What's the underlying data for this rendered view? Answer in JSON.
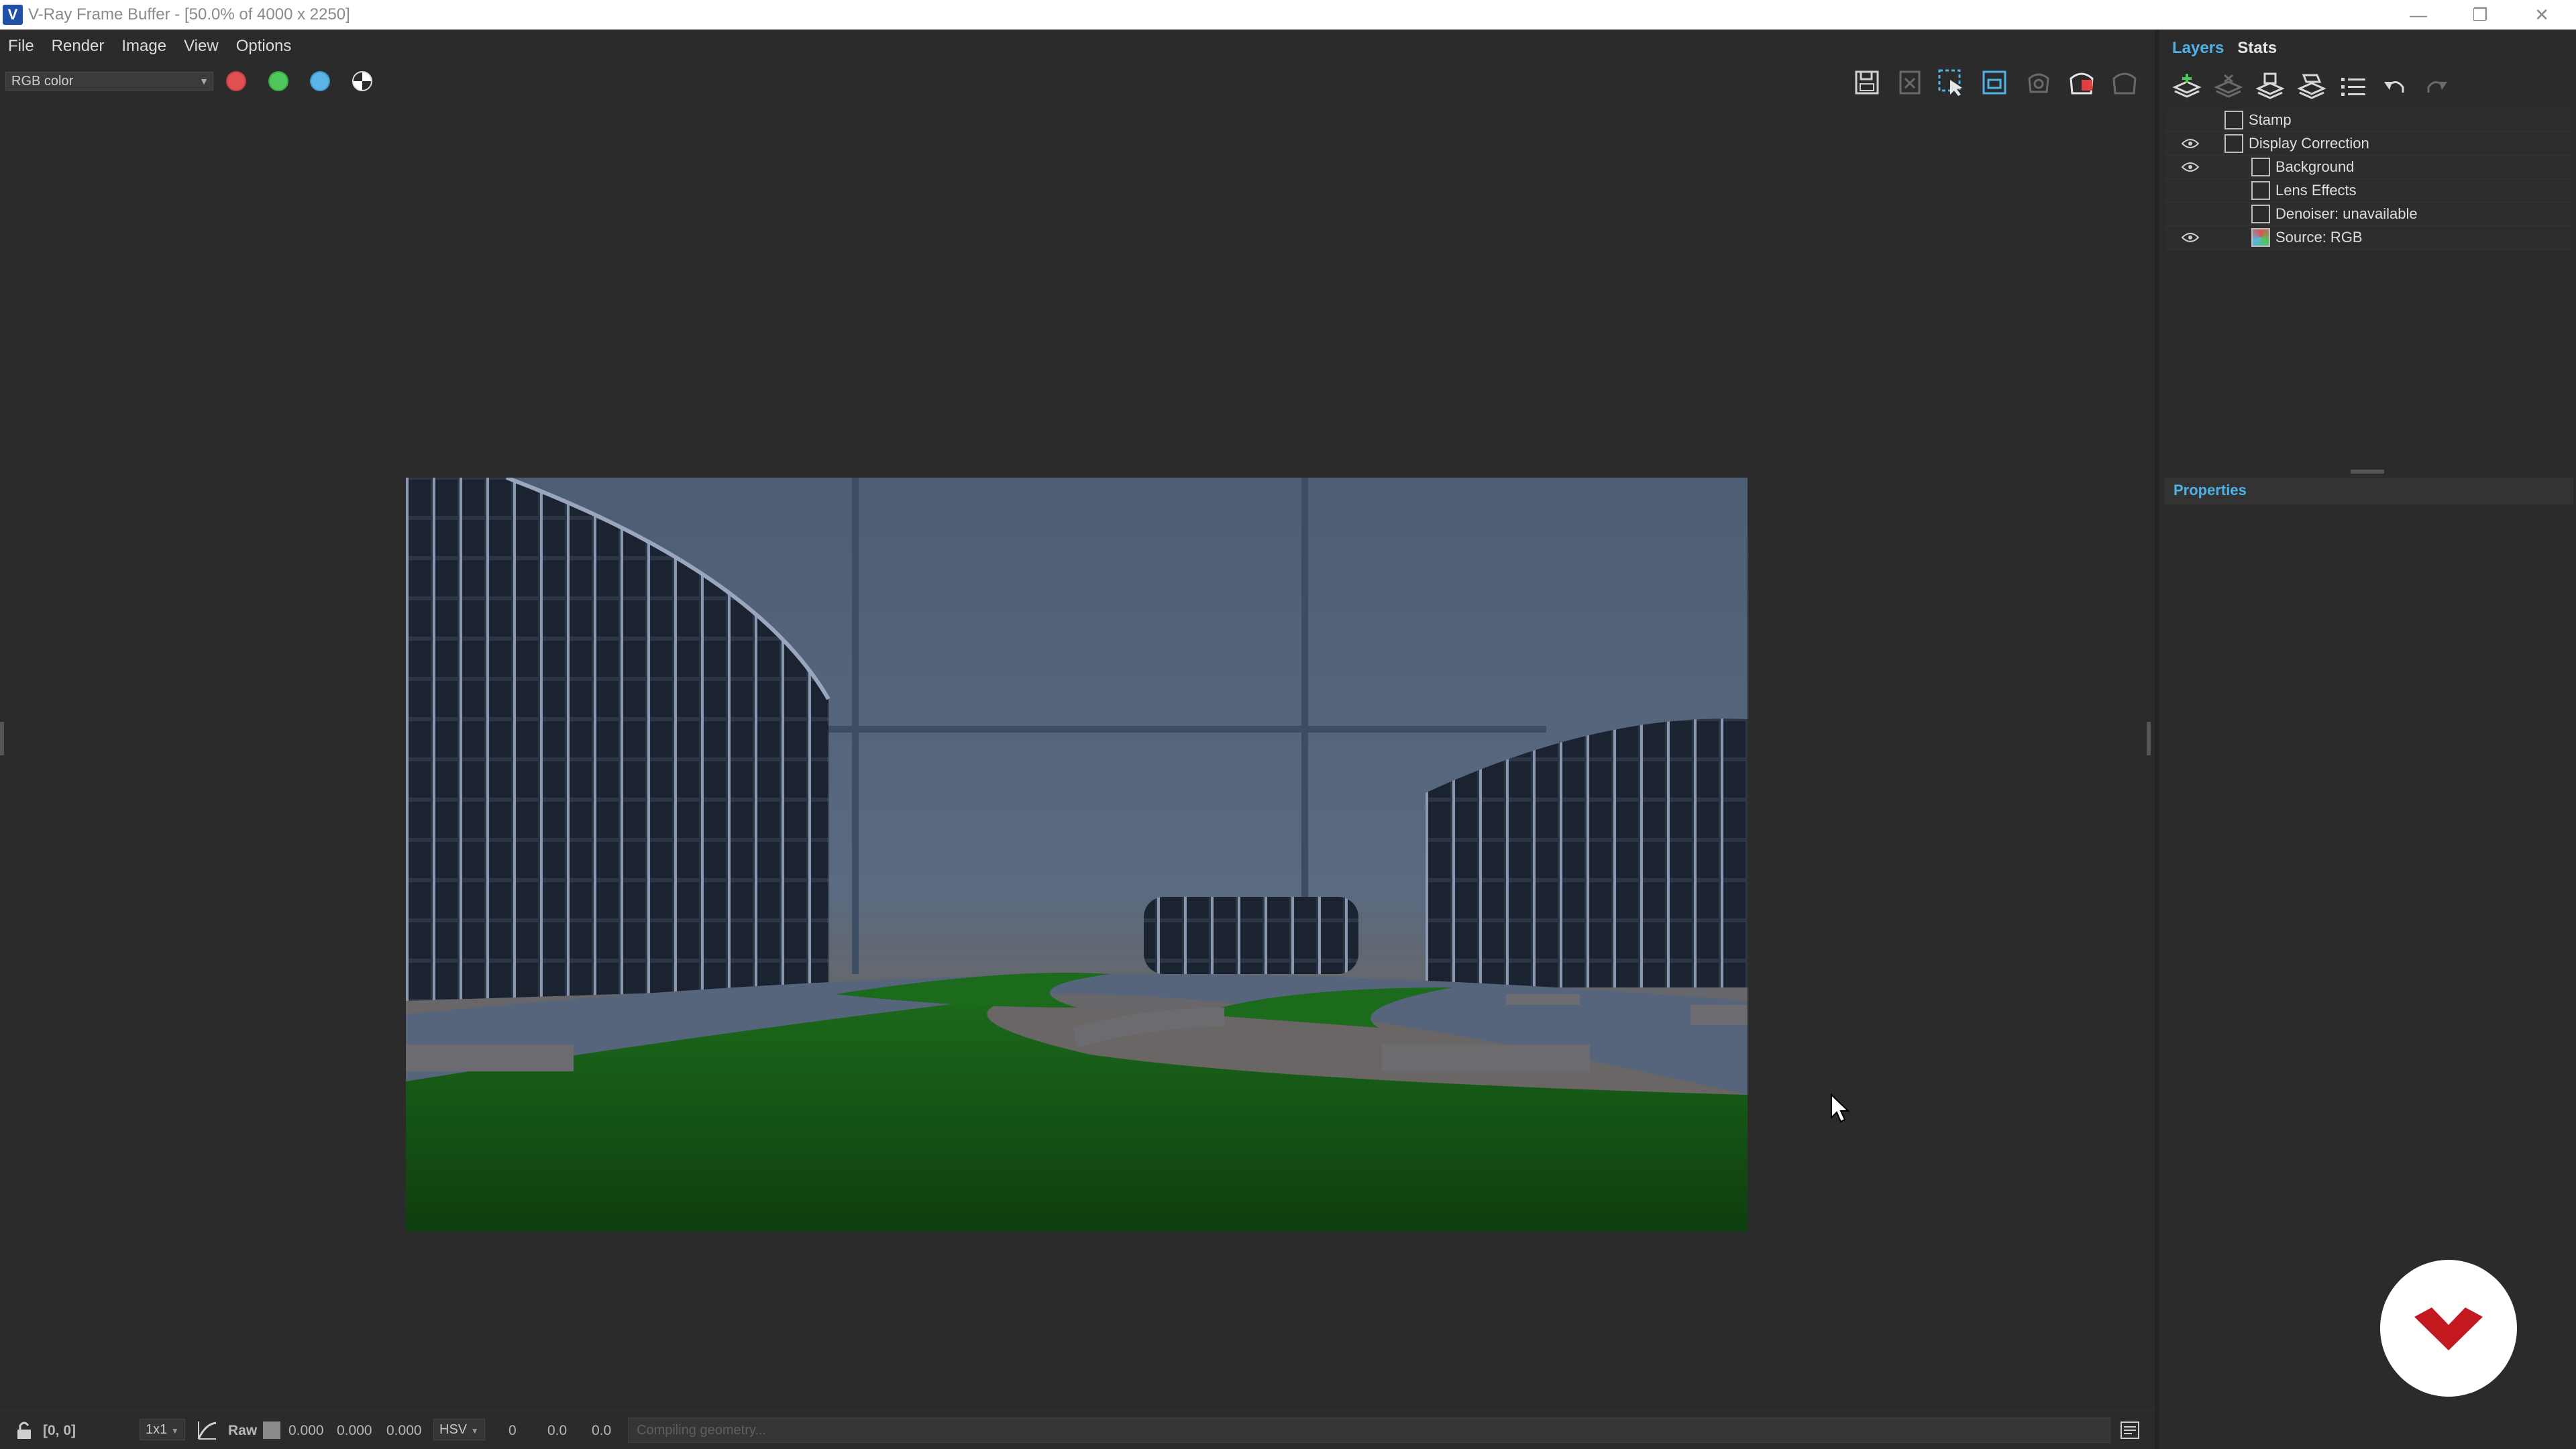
{
  "window": {
    "title": "V-Ray Frame Buffer - [50.0% of 4000 x 2250]",
    "minimize": "—",
    "restore": "❐",
    "close": "✕"
  },
  "menubar": {
    "items": [
      "File",
      "Render",
      "Image",
      "View",
      "Options"
    ]
  },
  "toolbar": {
    "channel_value": "RGB color",
    "colors": {
      "red": "#e05050",
      "green": "#4fc75a",
      "blue": "#5ab4e6"
    }
  },
  "rightpanel": {
    "tabs": [
      "Layers",
      "Stats"
    ],
    "layers": [
      {
        "name": "Stamp",
        "visible": false
      },
      {
        "name": "Display Correction",
        "visible": true
      },
      {
        "name": "Background",
        "visible": true
      },
      {
        "name": "Lens Effects",
        "visible": false
      },
      {
        "name": "Denoiser: unavailable",
        "visible": false
      },
      {
        "name": "Source: RGB",
        "visible": true
      }
    ],
    "properties_title": "Properties"
  },
  "statusbar": {
    "coords": "[0, 0]",
    "zoom": "1x1",
    "raw_label": "Raw",
    "rgb_values": [
      "0.000",
      "0.000",
      "0.000"
    ],
    "colorspace": "HSV",
    "hsv_values": [
      "0",
      "0.0",
      "0.0"
    ],
    "progress_text": "Compiling geometry..."
  }
}
